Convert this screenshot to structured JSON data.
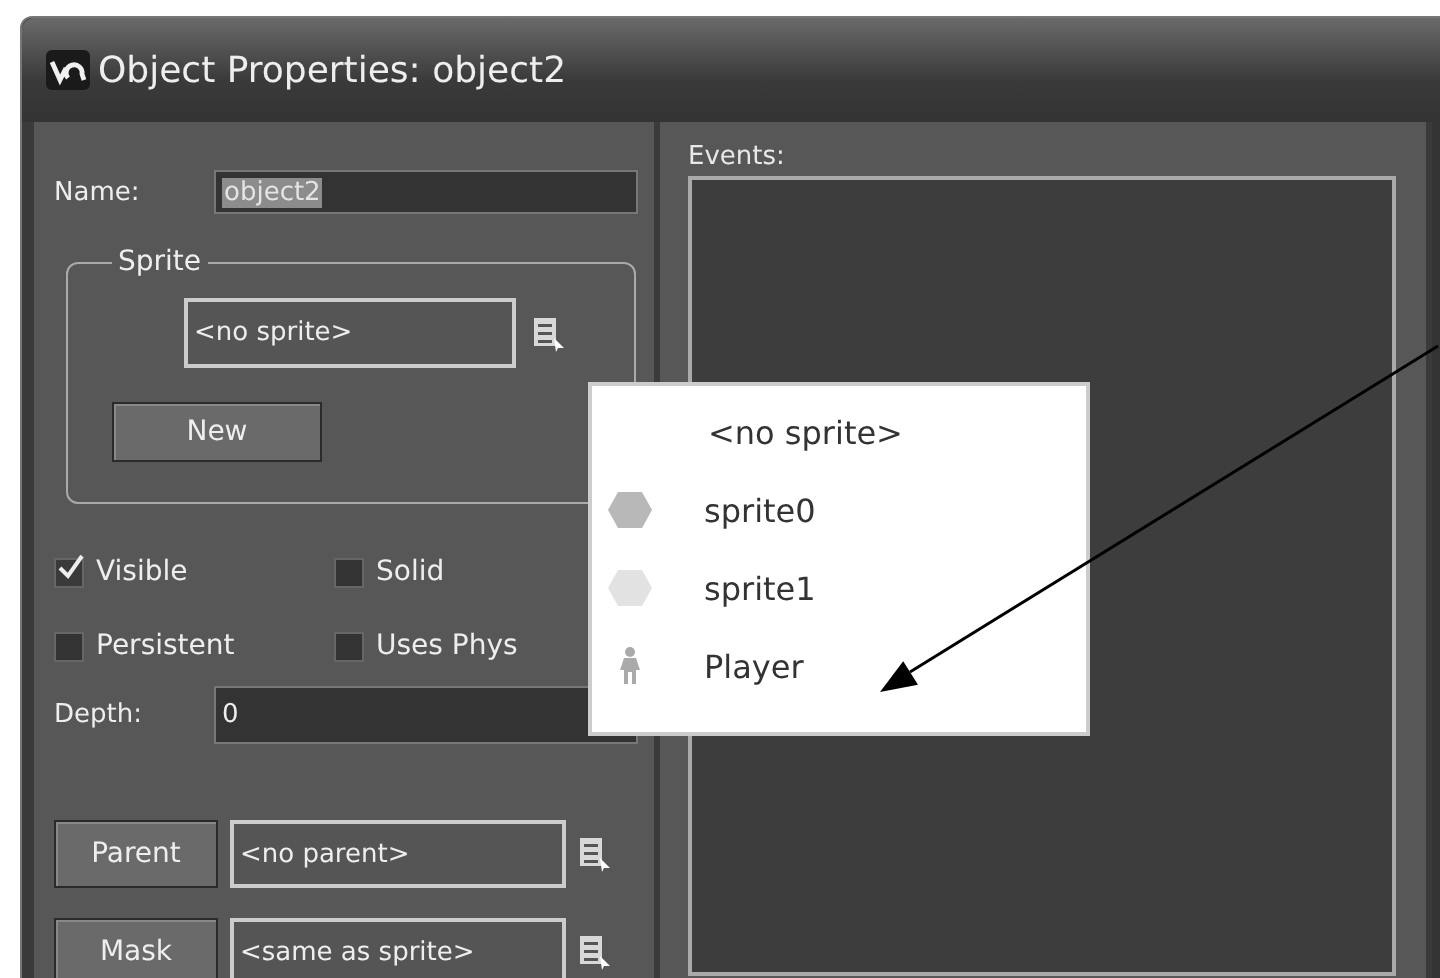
{
  "window": {
    "title": "Object Properties: object2"
  },
  "name": {
    "label": "Name:",
    "value": "object2"
  },
  "sprite": {
    "legend": "Sprite",
    "value": "<no sprite>",
    "button": "New"
  },
  "options": [
    {
      "label": "Visible",
      "checked": true
    },
    {
      "label": "Solid",
      "checked": false
    },
    {
      "label": "Persistent",
      "checked": false
    },
    {
      "label": "Uses Phys",
      "checked": false
    }
  ],
  "depth": {
    "label": "Depth:",
    "value": "0"
  },
  "parent": {
    "button": "Parent",
    "value": "<no parent>"
  },
  "mask": {
    "button": "Mask",
    "value": "<same as sprite>"
  },
  "events": {
    "label": "Events:"
  },
  "sprite_menu": [
    {
      "kind": "none",
      "label": "<no sprite>"
    },
    {
      "kind": "sprite",
      "label": "sprite0",
      "color": "#b8b8b8"
    },
    {
      "kind": "sprite",
      "label": "sprite1",
      "color": "#e2e2e2"
    },
    {
      "kind": "figure",
      "label": "Player"
    }
  ]
}
